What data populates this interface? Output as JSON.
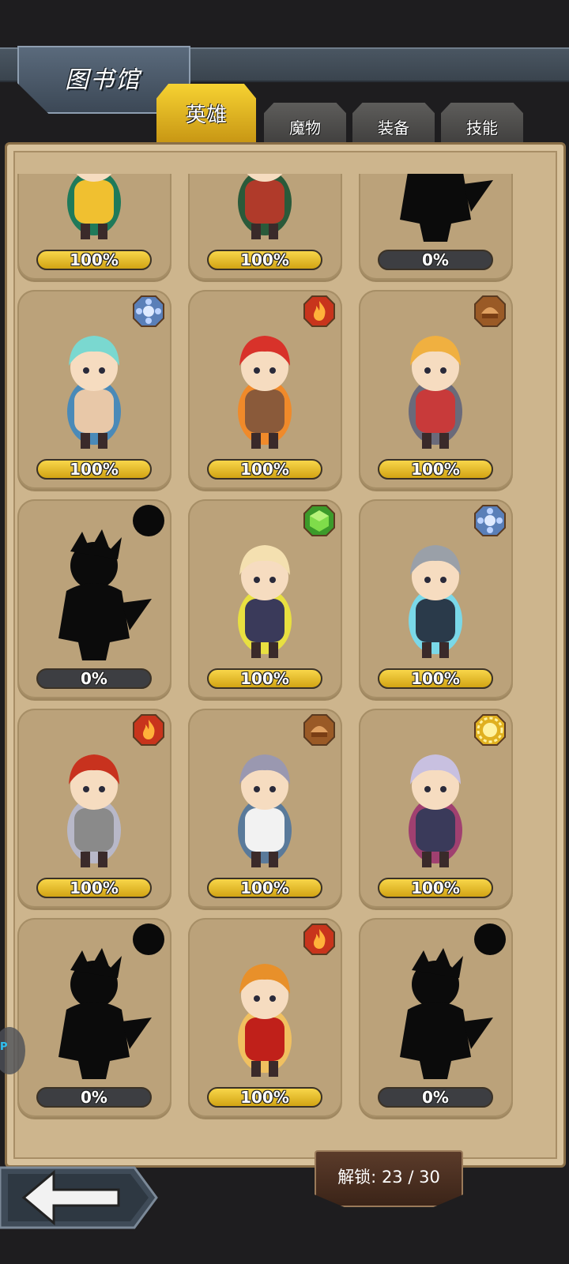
{
  "header": {
    "title": "图书馆"
  },
  "tabs": [
    {
      "label": "英雄",
      "active": true
    },
    {
      "label": "魔物",
      "active": false
    },
    {
      "label": "装备",
      "active": false
    },
    {
      "label": "技能",
      "active": false
    }
  ],
  "cards": [
    {
      "percent": "100%",
      "unlocked": true,
      "element": "none",
      "figure": "green-feather-hero"
    },
    {
      "percent": "100%",
      "unlocked": true,
      "element": "none",
      "figure": "samurai-hero"
    },
    {
      "percent": "0%",
      "unlocked": false,
      "element": "none",
      "figure": "silhouette"
    },
    {
      "percent": "100%",
      "unlocked": true,
      "element": "water",
      "figure": "teal-elf-archer"
    },
    {
      "percent": "100%",
      "unlocked": true,
      "element": "fire",
      "figure": "red-hair-archer"
    },
    {
      "percent": "100%",
      "unlocked": true,
      "element": "earth",
      "figure": "rifle-girl"
    },
    {
      "percent": "0%",
      "unlocked": false,
      "element": "dark",
      "figure": "silhouette"
    },
    {
      "percent": "100%",
      "unlocked": true,
      "element": "wind",
      "figure": "fox-girl-mage"
    },
    {
      "percent": "100%",
      "unlocked": true,
      "element": "water",
      "figure": "gray-hair-swordsman"
    },
    {
      "percent": "100%",
      "unlocked": true,
      "element": "fire",
      "figure": "red-hair-lancer"
    },
    {
      "percent": "100%",
      "unlocked": true,
      "element": "earth",
      "figure": "white-coat-girl"
    },
    {
      "percent": "100%",
      "unlocked": true,
      "element": "light",
      "figure": "twin-tail-scythe-girl"
    },
    {
      "percent": "0%",
      "unlocked": false,
      "element": "dark",
      "figure": "silhouette"
    },
    {
      "percent": "100%",
      "unlocked": true,
      "element": "fire",
      "figure": "fire-sorceress"
    },
    {
      "percent": "0%",
      "unlocked": false,
      "element": "dark",
      "figure": "silhouette"
    }
  ],
  "footer": {
    "unlock_text": "解锁: 23 / 30"
  },
  "colors": {
    "fire": "#c8341c",
    "water": "#5a7fb8",
    "earth": "#9a5a26",
    "wind": "#3c9a2a",
    "light": "#e0b020",
    "dark": "#0a0a0a"
  }
}
